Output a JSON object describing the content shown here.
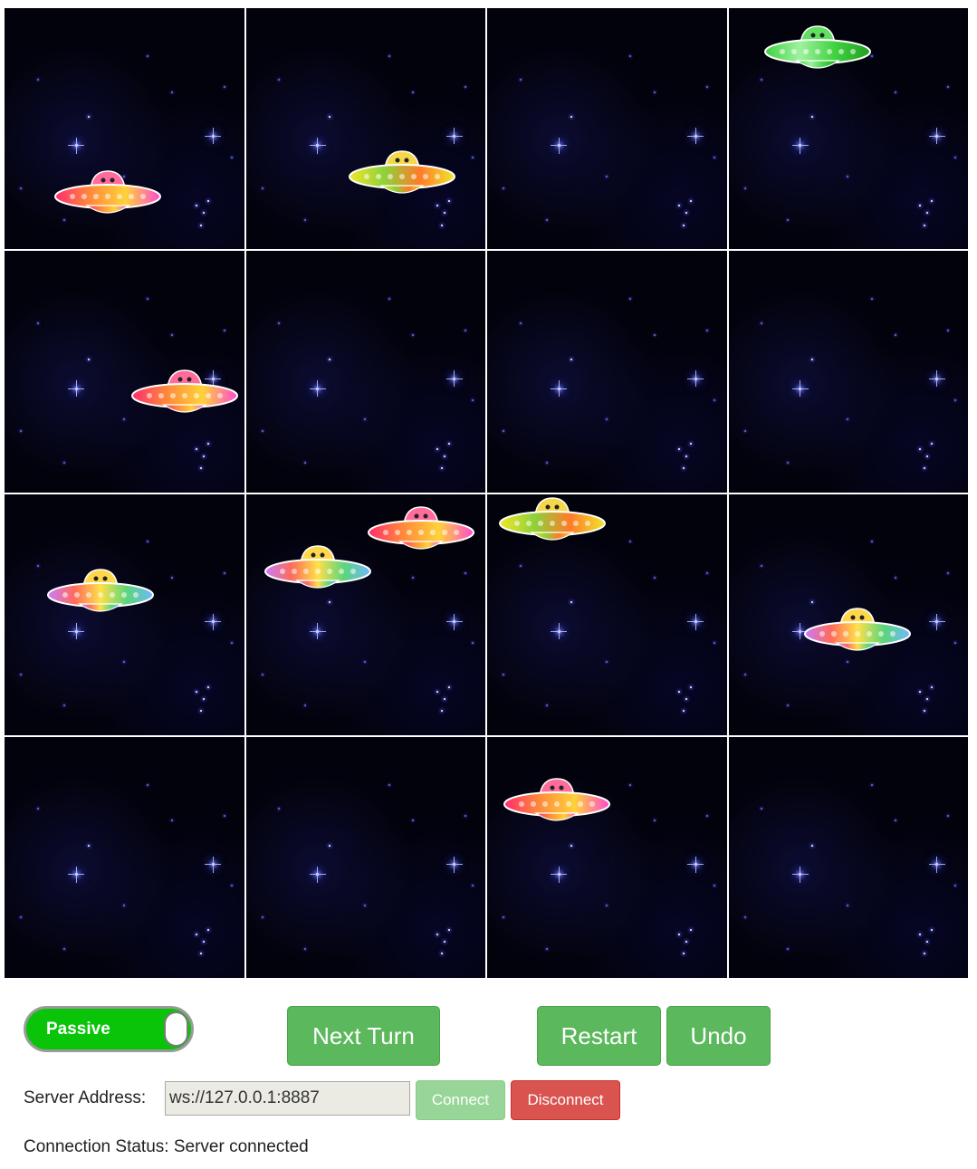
{
  "board": {
    "rows": 4,
    "cols": 4,
    "ufos": [
      {
        "cell": 0,
        "variant": "red"
      },
      {
        "cell": 1,
        "variant": "yellow"
      },
      {
        "cell": 3,
        "variant": "green"
      },
      {
        "cell": 4,
        "variant": "red"
      },
      {
        "cell": 8,
        "variant": "rainbow"
      },
      {
        "cell": 9,
        "variant": "rainbow"
      },
      {
        "cell": 9,
        "variant": "red"
      },
      {
        "cell": 10,
        "variant": "yellow"
      },
      {
        "cell": 11,
        "variant": "rainbow"
      },
      {
        "cell": 14,
        "variant": "red"
      }
    ]
  },
  "controls": {
    "mode_toggle": {
      "label": "Passive",
      "on": true
    },
    "next_turn_label": "Next Turn",
    "restart_label": "Restart",
    "undo_label": "Undo",
    "server_address_label": "Server Address:",
    "server_address_value": "ws://127.0.0.1:8887",
    "connect_label": "Connect",
    "disconnect_label": "Disconnect",
    "connection_status_label": "Connection Status:",
    "connection_status_value": "Server connected"
  },
  "colors": {
    "green_button": "#5cb85c",
    "toggle_on": "#0ac40a",
    "disconnect": "#d9534f",
    "connect_disabled": "#98d598"
  }
}
